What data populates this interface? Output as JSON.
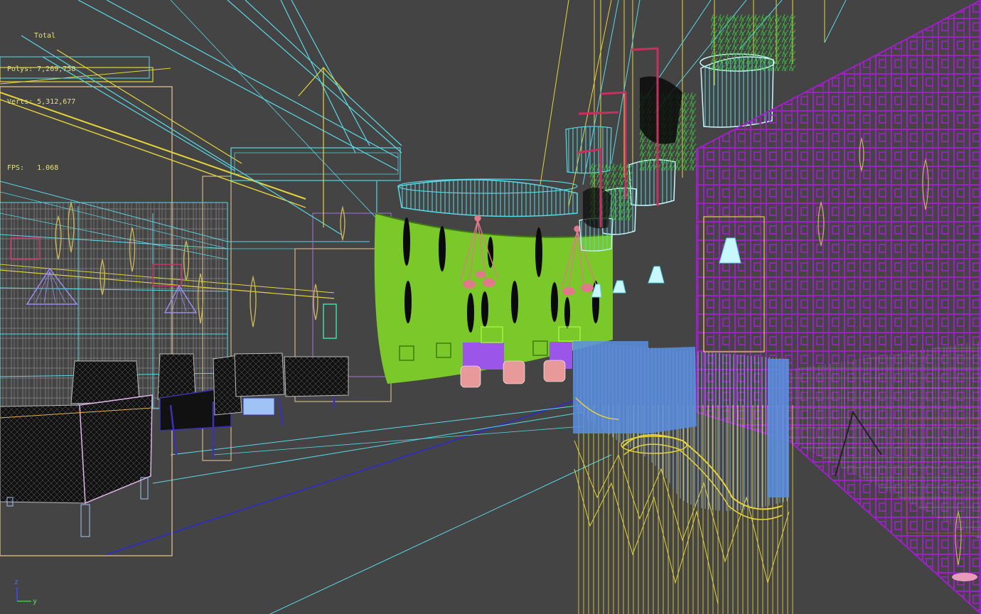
{
  "viewport": {
    "stats": {
      "title": "Total",
      "polys": "Polys: 7,269,758",
      "verts": "Verts: 5,312,677",
      "fps": "FPS:   1.068"
    },
    "axis_gizmo": {
      "z_label": "z",
      "y_label": "y"
    },
    "colors": {
      "background": "#444444",
      "stats_text": "#e6e07a",
      "cyan": "#59d8e6",
      "yellow": "#e6d43a",
      "purple": "#a020c8",
      "green": "#7ac82a",
      "blue": "#5a8ee0",
      "light_gray": "#bcbcbc",
      "olive": "#c8b45a",
      "pink": "#e07a8a"
    },
    "scene_objects": [
      "ceiling-beam",
      "bookshelf",
      "lounge-chair",
      "sofa",
      "green-curved-wall",
      "ring-chandelier",
      "pendant-lamp",
      "planter",
      "purple-lattice-screen",
      "blue-railing",
      "yellow-stair-mesh",
      "floor-lamp"
    ]
  }
}
